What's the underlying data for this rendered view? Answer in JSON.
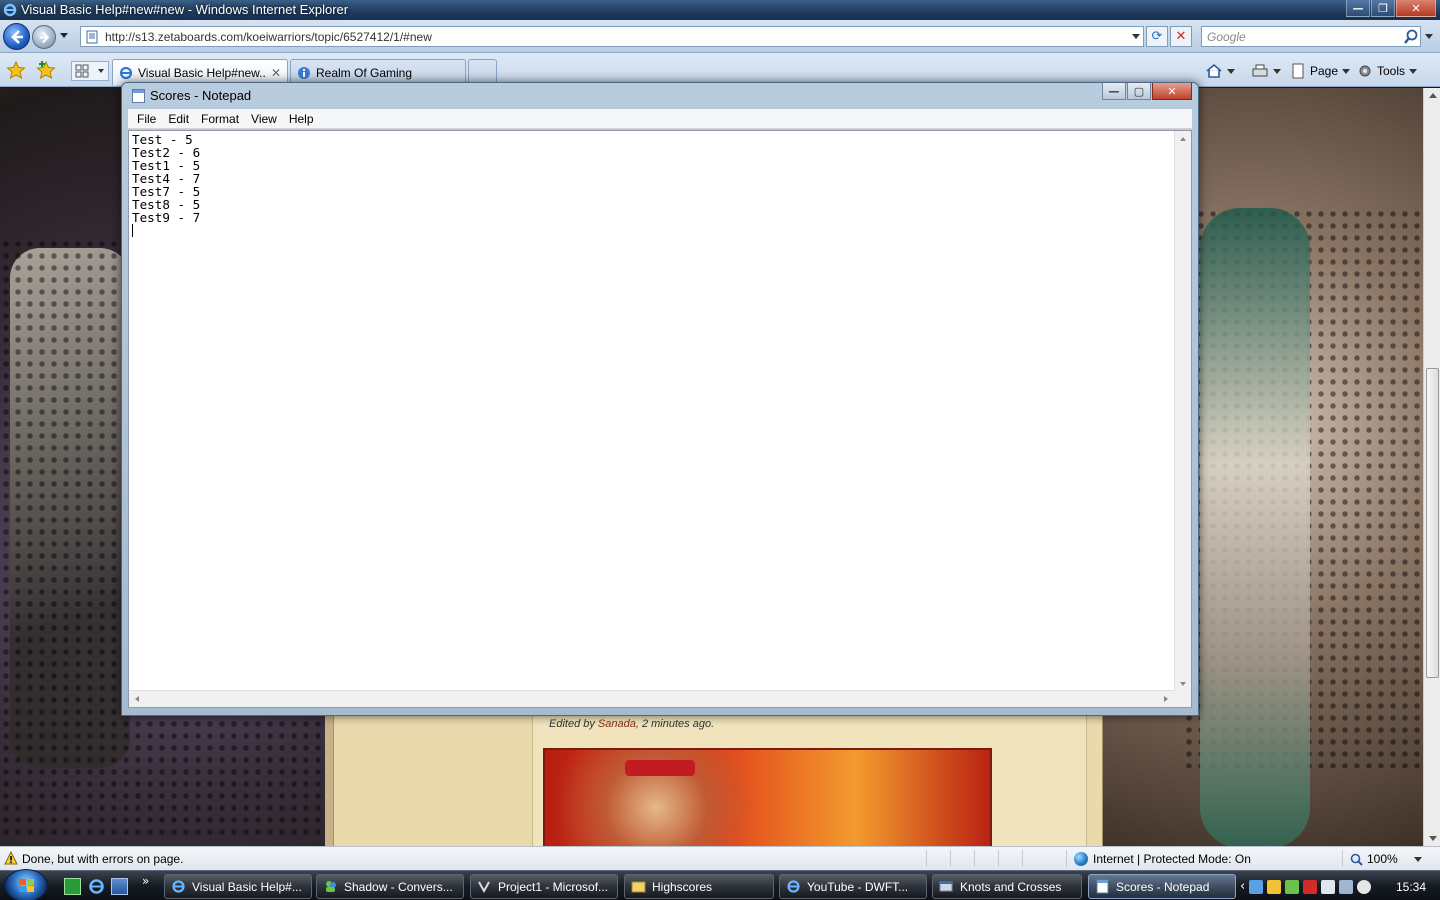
{
  "ie": {
    "title": "Visual Basic Help#new#new - Windows Internet Explorer",
    "url": "http://s13.zetaboards.com/koeiwarriors/topic/6527412/1/#new",
    "search_placeholder": "Google",
    "tabs": [
      {
        "label": "Visual Basic Help#new...",
        "active": true
      },
      {
        "label": "Realm Of Gaming",
        "active": false
      }
    ],
    "commands": {
      "page": "Page",
      "tools": "Tools"
    }
  },
  "page": {
    "edited_prefix": "Edited by ",
    "edited_user": "Sanada",
    "edited_suffix": ", 2 minutes ago."
  },
  "notepad": {
    "title": "Scores - Notepad",
    "menu": [
      "File",
      "Edit",
      "Format",
      "View",
      "Help"
    ],
    "content": "Test - 5\nTest2 - 6\nTest1 - 5\nTest4 - 7\nTest7 - 5\nTest8 - 5\nTest9 - 7\n"
  },
  "status": {
    "text": "Done, but with errors on page.",
    "zone": "Internet | Protected Mode: On",
    "zoom": "100%"
  },
  "taskbar": {
    "tasks": [
      {
        "label": "Visual Basic Help#...",
        "icon": "ie-icon",
        "active": false
      },
      {
        "label": "Shadow - Convers...",
        "icon": "messenger-icon",
        "active": false
      },
      {
        "label": "Project1 - Microsof...",
        "icon": "vb-icon",
        "active": false
      },
      {
        "label": "Highscores",
        "icon": "folder-icon",
        "active": false
      },
      {
        "label": "YouTube - DWFT...",
        "icon": "ie-icon",
        "active": false
      },
      {
        "label": "Knots and Crosses",
        "icon": "form-icon",
        "active": false
      },
      {
        "label": "Scores - Notepad",
        "icon": "notepad-icon",
        "active": true
      }
    ],
    "clock": "15:34"
  },
  "colors": {
    "ie_accent": "#1e5fc4",
    "close_red": "#c0412a",
    "forum_bg": "#ead9ad"
  }
}
